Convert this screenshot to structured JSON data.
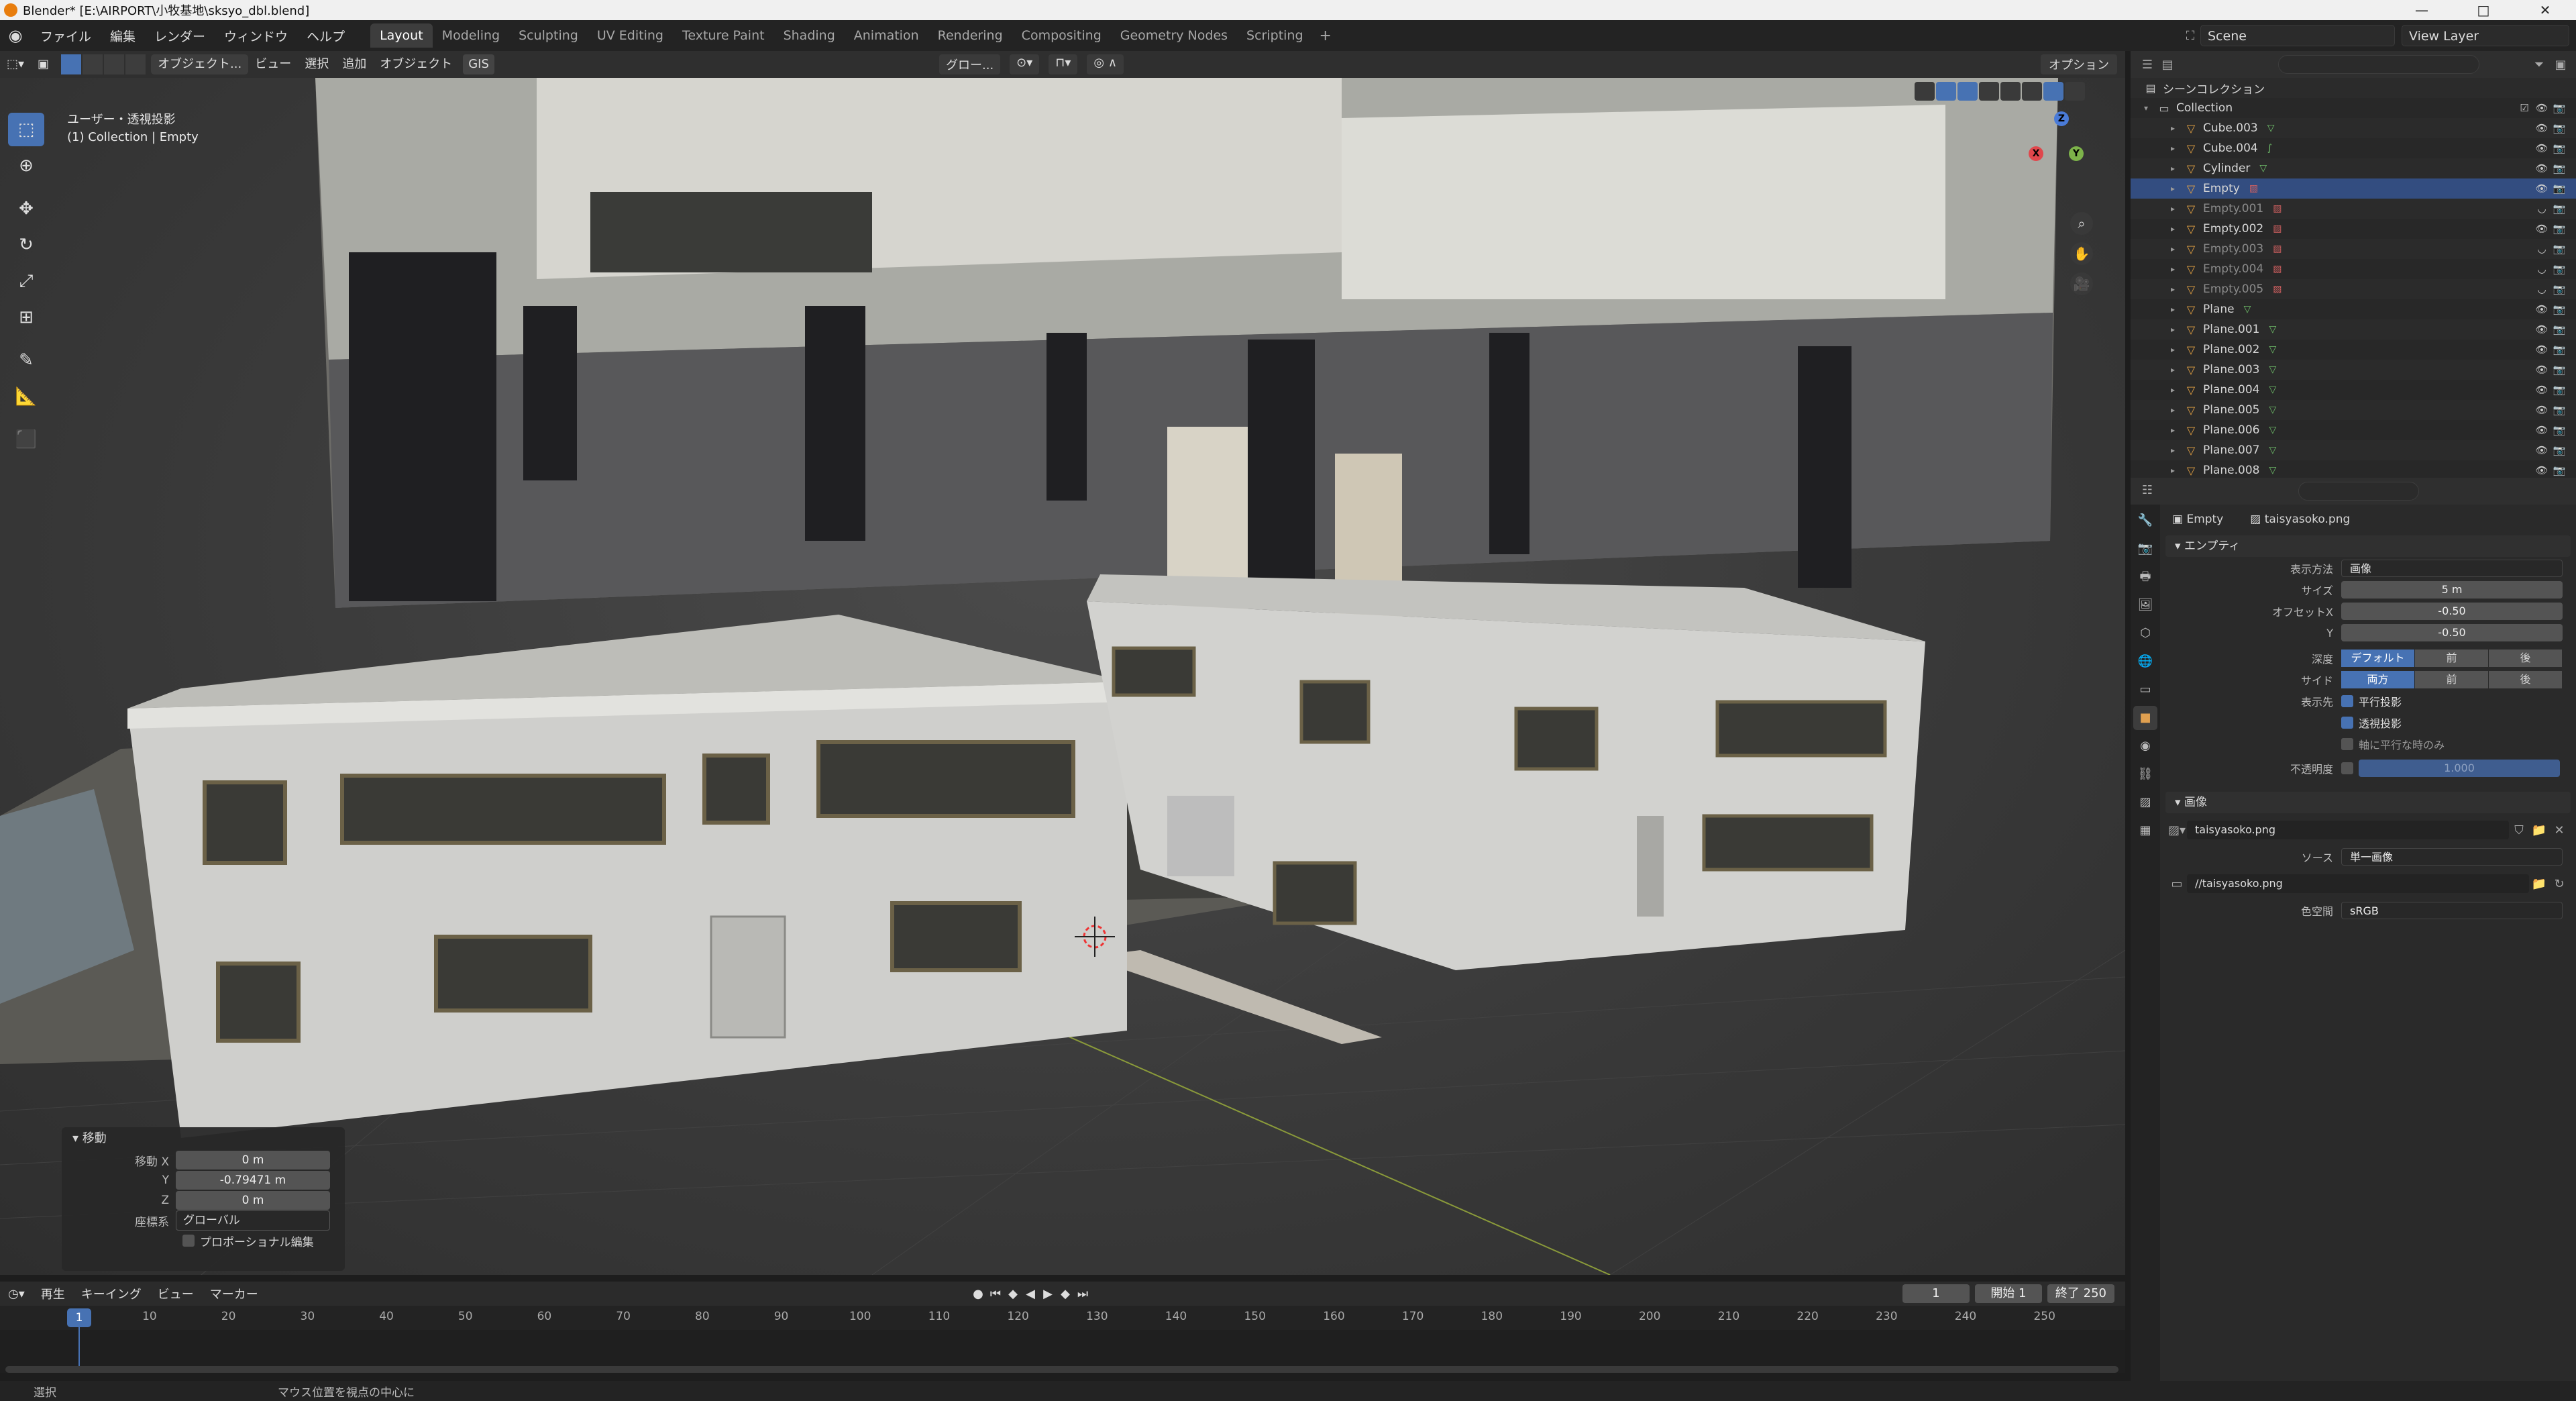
{
  "window": {
    "title": "Blender* [E:\\AIRPORT\\小牧基地\\sksyo_dbl.blend]",
    "controls": [
      "—",
      "□",
      "✕"
    ]
  },
  "menubar": {
    "menus": [
      "ファイル",
      "編集",
      "レンダー",
      "ウィンドウ",
      "ヘルプ"
    ],
    "workspaces": [
      "Layout",
      "Modeling",
      "Sculpting",
      "UV Editing",
      "Texture Paint",
      "Shading",
      "Animation",
      "Rendering",
      "Compositing",
      "Geometry Nodes",
      "Scripting"
    ],
    "active_workspace": "Layout",
    "scene": "Scene",
    "view_layer": "View Layer"
  },
  "viewport_header": {
    "mode": "オブジェクト...",
    "menus": [
      "ビュー",
      "選択",
      "追加",
      "オブジェクト",
      "GIS"
    ],
    "transform_orientation": "グロー...",
    "options": "オプション"
  },
  "viewport": {
    "view_name": "ユーザー・透視投影",
    "context": "(1) Collection | Empty",
    "tools": [
      "select-icon",
      "cursor-icon",
      "move-icon",
      "rotate-icon",
      "scale-icon",
      "transform-icon",
      "annotate-icon",
      "measure-icon",
      "add-cube-icon"
    ],
    "gizmo_axes": [
      "X",
      "Y",
      "Z"
    ],
    "background_ref": "taisyasoko.png"
  },
  "redo_panel": {
    "title": "移動",
    "fields": [
      {
        "label": "移動 X",
        "value": "0 m"
      },
      {
        "label": "Y",
        "value": "-0.79471 m"
      },
      {
        "label": "Z",
        "value": "0 m"
      }
    ],
    "orientation_label": "座標系",
    "orientation_value": "グローバル",
    "proportional_label": "プロポーショナル編集"
  },
  "timeline": {
    "menus": [
      "再生",
      "キーイング",
      "ビュー",
      "マーカー"
    ],
    "current_frame": "1",
    "start_label": "開始",
    "start": "1",
    "end_label": "終了",
    "end": "250",
    "ticks": [
      "10",
      "20",
      "30",
      "40",
      "50",
      "60",
      "70",
      "80",
      "90",
      "100",
      "110",
      "120",
      "130",
      "140",
      "150",
      "160",
      "170",
      "180",
      "190",
      "200",
      "210",
      "220",
      "230",
      "240",
      "250"
    ]
  },
  "statusbar": {
    "select": "選択",
    "hint": "マウス位置を視点の中心に"
  },
  "outliner": {
    "root": "シーンコレクション",
    "collection": "Collection",
    "items": [
      {
        "name": "Cube.003",
        "kind": "mesh",
        "selected": false,
        "dim": false
      },
      {
        "name": "Cube.004",
        "kind": "curve",
        "selected": false,
        "dim": false
      },
      {
        "name": "Cylinder",
        "kind": "mesh",
        "selected": false,
        "dim": false
      },
      {
        "name": "Empty",
        "kind": "empty",
        "selected": true,
        "dim": false
      },
      {
        "name": "Empty.001",
        "kind": "empty",
        "selected": false,
        "dim": true
      },
      {
        "name": "Empty.002",
        "kind": "empty",
        "selected": false,
        "dim": false
      },
      {
        "name": "Empty.003",
        "kind": "empty",
        "selected": false,
        "dim": true
      },
      {
        "name": "Empty.004",
        "kind": "empty",
        "selected": false,
        "dim": true
      },
      {
        "name": "Empty.005",
        "kind": "empty",
        "selected": false,
        "dim": true
      },
      {
        "name": "Plane",
        "kind": "mesh",
        "selected": false,
        "dim": false
      },
      {
        "name": "Plane.001",
        "kind": "mesh",
        "selected": false,
        "dim": false
      },
      {
        "name": "Plane.002",
        "kind": "mesh",
        "selected": false,
        "dim": false
      },
      {
        "name": "Plane.003",
        "kind": "mesh",
        "selected": false,
        "dim": false
      },
      {
        "name": "Plane.004",
        "kind": "mesh",
        "selected": false,
        "dim": false
      },
      {
        "name": "Plane.005",
        "kind": "mesh",
        "selected": false,
        "dim": false
      },
      {
        "name": "Plane.006",
        "kind": "mesh",
        "selected": false,
        "dim": false
      },
      {
        "name": "Plane.007",
        "kind": "mesh",
        "selected": false,
        "dim": false
      },
      {
        "name": "Plane.008",
        "kind": "mesh",
        "selected": false,
        "dim": false
      }
    ]
  },
  "properties": {
    "object": "Empty",
    "data": "taisyasoko.png",
    "empty_panel": "エンプティ",
    "display_as_label": "表示方法",
    "display_as": "画像",
    "size_label": "サイズ",
    "size": "5 m",
    "offset_x_label": "オフセットX",
    "offset_x": "-0.50",
    "offset_y_label": "Y",
    "offset_y": "-0.50",
    "depth_label": "深度",
    "depth_options": [
      "デフォルト",
      "前",
      "後"
    ],
    "side_label": "サイド",
    "side_options": [
      "両方",
      "前",
      "後"
    ],
    "show_label": "表示先",
    "show_ortho": "平行投影",
    "show_persp": "透視投影",
    "show_axis_aligned": "軸に平行な時のみ",
    "opacity_label": "不透明度",
    "opacity": "1.000",
    "image_panel": "画像",
    "image_name": "taisyasoko.png",
    "source_label": "ソース",
    "source": "単一画像",
    "filepath": "//taisyasoko.png",
    "colorspace_label": "色空間",
    "colorspace": "sRGB"
  }
}
